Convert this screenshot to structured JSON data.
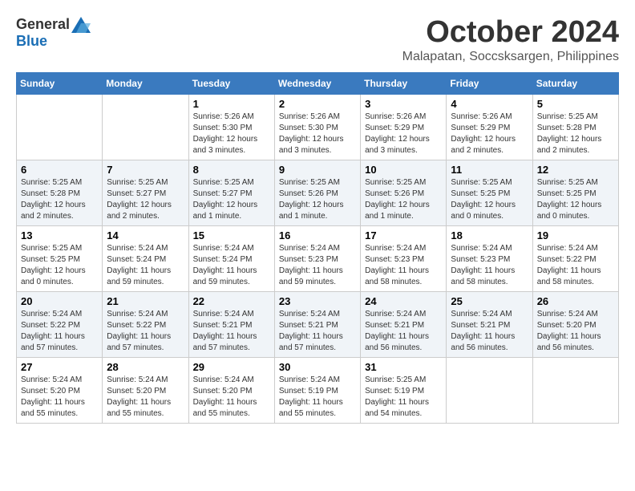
{
  "logo": {
    "general": "General",
    "blue": "Blue"
  },
  "title": "October 2024",
  "location": "Malapatan, Soccsksargen, Philippines",
  "days": [
    "Sunday",
    "Monday",
    "Tuesday",
    "Wednesday",
    "Thursday",
    "Friday",
    "Saturday"
  ],
  "weeks": [
    [
      {
        "day": "",
        "info": ""
      },
      {
        "day": "",
        "info": ""
      },
      {
        "day": "1",
        "info": "Sunrise: 5:26 AM\nSunset: 5:30 PM\nDaylight: 12 hours and 3 minutes."
      },
      {
        "day": "2",
        "info": "Sunrise: 5:26 AM\nSunset: 5:30 PM\nDaylight: 12 hours and 3 minutes."
      },
      {
        "day": "3",
        "info": "Sunrise: 5:26 AM\nSunset: 5:29 PM\nDaylight: 12 hours and 3 minutes."
      },
      {
        "day": "4",
        "info": "Sunrise: 5:26 AM\nSunset: 5:29 PM\nDaylight: 12 hours and 2 minutes."
      },
      {
        "day": "5",
        "info": "Sunrise: 5:25 AM\nSunset: 5:28 PM\nDaylight: 12 hours and 2 minutes."
      }
    ],
    [
      {
        "day": "6",
        "info": "Sunrise: 5:25 AM\nSunset: 5:28 PM\nDaylight: 12 hours and 2 minutes."
      },
      {
        "day": "7",
        "info": "Sunrise: 5:25 AM\nSunset: 5:27 PM\nDaylight: 12 hours and 2 minutes."
      },
      {
        "day": "8",
        "info": "Sunrise: 5:25 AM\nSunset: 5:27 PM\nDaylight: 12 hours and 1 minute."
      },
      {
        "day": "9",
        "info": "Sunrise: 5:25 AM\nSunset: 5:26 PM\nDaylight: 12 hours and 1 minute."
      },
      {
        "day": "10",
        "info": "Sunrise: 5:25 AM\nSunset: 5:26 PM\nDaylight: 12 hours and 1 minute."
      },
      {
        "day": "11",
        "info": "Sunrise: 5:25 AM\nSunset: 5:25 PM\nDaylight: 12 hours and 0 minutes."
      },
      {
        "day": "12",
        "info": "Sunrise: 5:25 AM\nSunset: 5:25 PM\nDaylight: 12 hours and 0 minutes."
      }
    ],
    [
      {
        "day": "13",
        "info": "Sunrise: 5:25 AM\nSunset: 5:25 PM\nDaylight: 12 hours and 0 minutes."
      },
      {
        "day": "14",
        "info": "Sunrise: 5:24 AM\nSunset: 5:24 PM\nDaylight: 11 hours and 59 minutes."
      },
      {
        "day": "15",
        "info": "Sunrise: 5:24 AM\nSunset: 5:24 PM\nDaylight: 11 hours and 59 minutes."
      },
      {
        "day": "16",
        "info": "Sunrise: 5:24 AM\nSunset: 5:23 PM\nDaylight: 11 hours and 59 minutes."
      },
      {
        "day": "17",
        "info": "Sunrise: 5:24 AM\nSunset: 5:23 PM\nDaylight: 11 hours and 58 minutes."
      },
      {
        "day": "18",
        "info": "Sunrise: 5:24 AM\nSunset: 5:23 PM\nDaylight: 11 hours and 58 minutes."
      },
      {
        "day": "19",
        "info": "Sunrise: 5:24 AM\nSunset: 5:22 PM\nDaylight: 11 hours and 58 minutes."
      }
    ],
    [
      {
        "day": "20",
        "info": "Sunrise: 5:24 AM\nSunset: 5:22 PM\nDaylight: 11 hours and 57 minutes."
      },
      {
        "day": "21",
        "info": "Sunrise: 5:24 AM\nSunset: 5:22 PM\nDaylight: 11 hours and 57 minutes."
      },
      {
        "day": "22",
        "info": "Sunrise: 5:24 AM\nSunset: 5:21 PM\nDaylight: 11 hours and 57 minutes."
      },
      {
        "day": "23",
        "info": "Sunrise: 5:24 AM\nSunset: 5:21 PM\nDaylight: 11 hours and 57 minutes."
      },
      {
        "day": "24",
        "info": "Sunrise: 5:24 AM\nSunset: 5:21 PM\nDaylight: 11 hours and 56 minutes."
      },
      {
        "day": "25",
        "info": "Sunrise: 5:24 AM\nSunset: 5:21 PM\nDaylight: 11 hours and 56 minutes."
      },
      {
        "day": "26",
        "info": "Sunrise: 5:24 AM\nSunset: 5:20 PM\nDaylight: 11 hours and 56 minutes."
      }
    ],
    [
      {
        "day": "27",
        "info": "Sunrise: 5:24 AM\nSunset: 5:20 PM\nDaylight: 11 hours and 55 minutes."
      },
      {
        "day": "28",
        "info": "Sunrise: 5:24 AM\nSunset: 5:20 PM\nDaylight: 11 hours and 55 minutes."
      },
      {
        "day": "29",
        "info": "Sunrise: 5:24 AM\nSunset: 5:20 PM\nDaylight: 11 hours and 55 minutes."
      },
      {
        "day": "30",
        "info": "Sunrise: 5:24 AM\nSunset: 5:19 PM\nDaylight: 11 hours and 55 minutes."
      },
      {
        "day": "31",
        "info": "Sunrise: 5:25 AM\nSunset: 5:19 PM\nDaylight: 11 hours and 54 minutes."
      },
      {
        "day": "",
        "info": ""
      },
      {
        "day": "",
        "info": ""
      }
    ]
  ]
}
